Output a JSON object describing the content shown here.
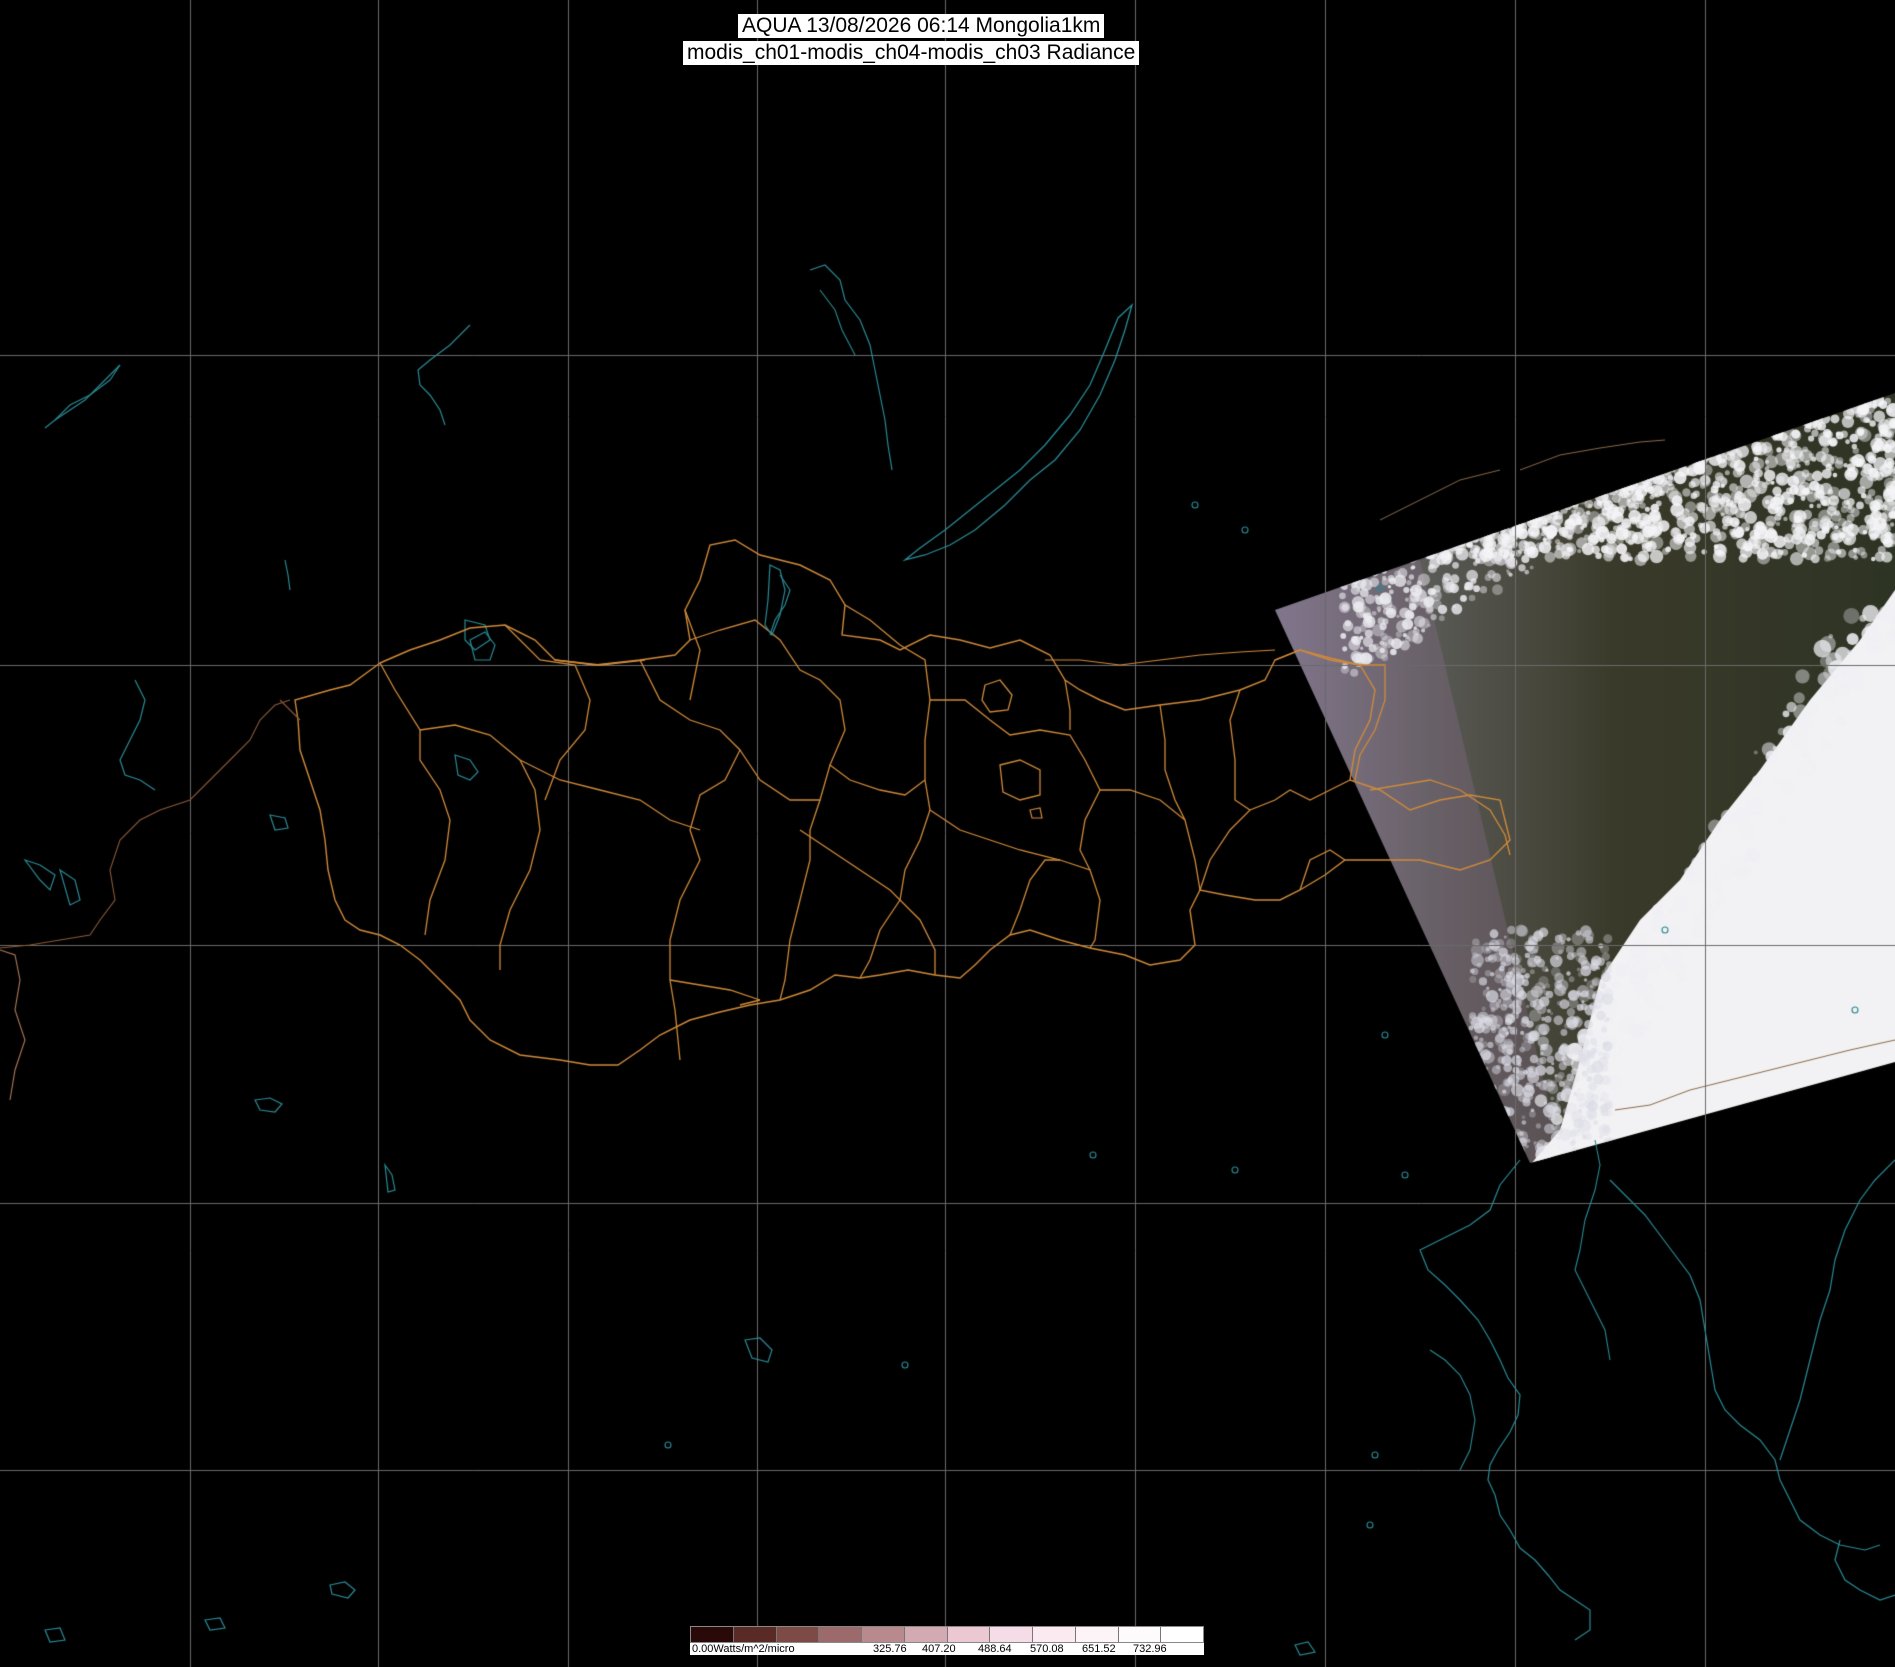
{
  "title": {
    "line1": "AQUA 13/08/2026 06:14 Mongolia1km",
    "line2": "modis_ch01-modis_ch04-modis_ch03 Radiance"
  },
  "colorbar": {
    "unit_label": "0.00Watts/m^2/micro",
    "tick_labels": [
      "325.76",
      "407.20",
      "488.64",
      "570.08",
      "651.52",
      "732.96"
    ],
    "colors": [
      "#2a0a08",
      "#5a2a26",
      "#7e4a46",
      "#9c6a6a",
      "#b88a8e",
      "#d4aab2",
      "#ecc8d2",
      "#f6dce6",
      "#fbeaf0",
      "#fdf4f8",
      "#fefbfd",
      "#ffffff"
    ]
  },
  "colors": {
    "background": "#000000",
    "graticule": "#6a6a6a",
    "coastline": "#2a8a95",
    "admin_boundary": "#d08a3a",
    "cloud": "#f2f2f4",
    "vegetation": "#3a3c28"
  }
}
